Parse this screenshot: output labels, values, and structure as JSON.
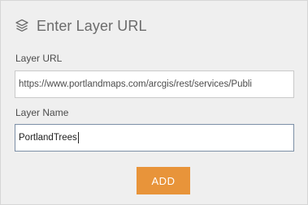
{
  "header": {
    "icon": "layers-icon",
    "title": "Enter Layer URL"
  },
  "form": {
    "layer_url": {
      "label": "Layer URL",
      "value": "https://www.portlandmaps.com/arcgis/rest/services/Publi"
    },
    "layer_name": {
      "label": "Layer Name",
      "value": "PortlandTrees"
    },
    "add_label": "ADD"
  },
  "colors": {
    "panel_background": "#efefef",
    "add_button": "#e8943a",
    "focused_border": "#7c8fa6"
  }
}
